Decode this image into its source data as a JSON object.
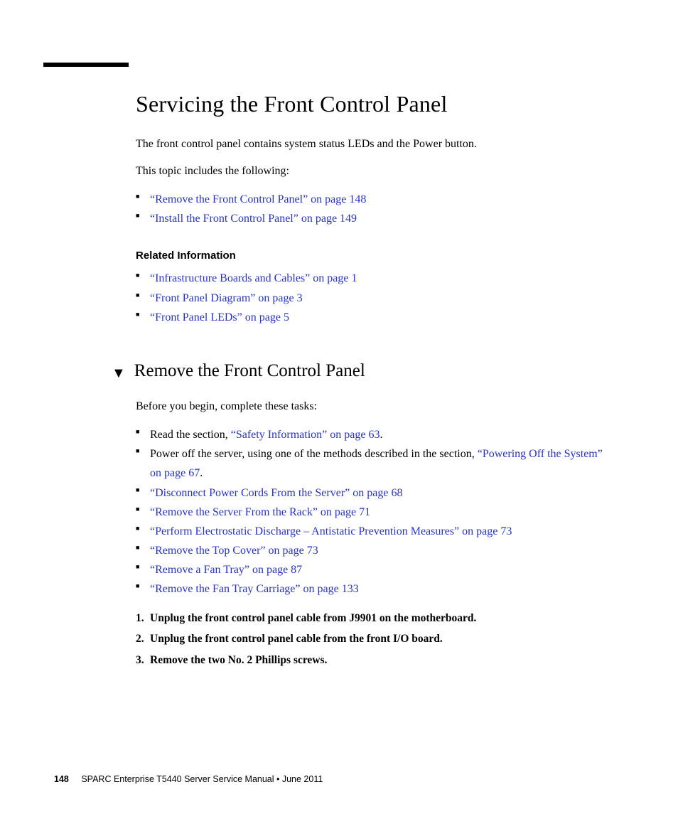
{
  "title": "Servicing the Front Control Panel",
  "intro1": "The front control panel contains system status LEDs and the Power button.",
  "intro2": "This topic includes the following:",
  "topic_links": [
    "“Remove the Front Control Panel” on page 148",
    "“Install the Front Control Panel” on page 149"
  ],
  "related_heading": "Related Information",
  "related_links": [
    "“Infrastructure Boards and Cables” on page 1",
    "“Front Panel Diagram” on page 3",
    "“Front Panel LEDs” on page 5"
  ],
  "sub_title": "Remove the Front Control Panel",
  "before_text": "Before you begin, complete these tasks:",
  "task_items": {
    "t0_pre": "Read the section, ",
    "t0_link": "“Safety Information” on page 63",
    "t0_post": ".",
    "t1_pre": "Power off the server, using one of the methods described in the section, ",
    "t1_link": "“Powering Off the System” on page 67",
    "t1_post": ".",
    "t2": "“Disconnect Power Cords From the Server” on page 68",
    "t3": "“Remove the Server From the Rack” on page 71",
    "t4": "“Perform Electrostatic Discharge – Antistatic Prevention Measures” on page 73",
    "t5": "“Remove the Top Cover” on page 73",
    "t6": "“Remove a Fan Tray” on page 87",
    "t7": "“Remove the Fan Tray Carriage” on page 133"
  },
  "steps": [
    "Unplug the front control panel cable from J9901 on the motherboard.",
    "Unplug the front control panel cable from the front I/O board.",
    "Remove the two No. 2 Phillips screws."
  ],
  "footer": {
    "page": "148",
    "text": "SPARC Enterprise T5440 Server Service Manual  •  June 2011"
  }
}
